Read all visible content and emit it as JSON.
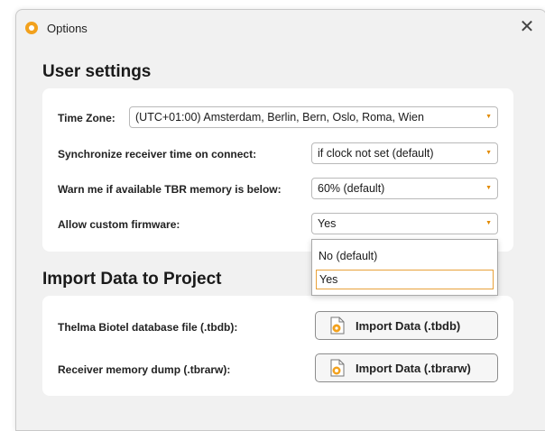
{
  "window": {
    "title": "Options",
    "close_glyph": "✕",
    "app_icon": "gear-icon",
    "accent_color": "#f2a11d"
  },
  "user_settings": {
    "heading": "User settings",
    "time_zone": {
      "label": "Time Zone:",
      "value": "(UTC+01:00) Amsterdam, Berlin, Bern, Oslo, Roma, Wien"
    },
    "sync_time": {
      "label": "Synchronize receiver time on connect:",
      "value": "if clock not set (default)"
    },
    "tbr_memory": {
      "label": "Warn me if available TBR memory is below:",
      "value": "60% (default)"
    },
    "custom_firmware": {
      "label": "Allow custom firmware:",
      "value": "Yes",
      "options": [
        "No (default)",
        "Yes"
      ],
      "highlighted": "Yes"
    }
  },
  "import": {
    "heading": "Import Data to Project",
    "tbdb": {
      "label": "Thelma Biotel database file (.tbdb):",
      "button": "Import Data (.tbdb)",
      "icon": "database-file-icon"
    },
    "tbrarw": {
      "label": "Receiver memory dump (.tbrarw):",
      "button": "Import Data (.tbrarw)",
      "icon": "memory-dump-file-icon"
    }
  }
}
